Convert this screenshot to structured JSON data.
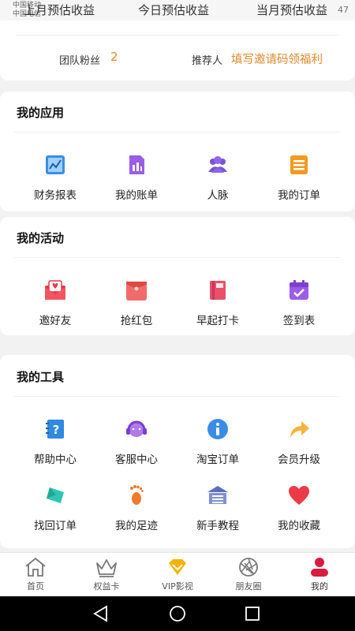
{
  "status_bar": {
    "carrier_top": "中国移动",
    "carrier_bottom": "中国电信",
    "ghost_labels": [
      "上月预估收益",
      "今日预估收益",
      "当月预估收益"
    ],
    "time": "47"
  },
  "fans": {
    "label": "团队粉丝",
    "value": "2",
    "referrer_label": "推荐人",
    "referrer_link": "填写邀请码领福利"
  },
  "sections": {
    "apps": {
      "title": "我的应用",
      "items": [
        {
          "label": "财务报表",
          "icon": "finance-report-icon"
        },
        {
          "label": "我的账单",
          "icon": "bill-icon"
        },
        {
          "label": "人脉",
          "icon": "contacts-icon"
        },
        {
          "label": "我的订单",
          "icon": "orders-icon"
        }
      ]
    },
    "activities": {
      "title": "我的活动",
      "items": [
        {
          "label": "邀好友",
          "icon": "invite-envelope-icon"
        },
        {
          "label": "抢红包",
          "icon": "red-envelope-icon"
        },
        {
          "label": "早起打卡",
          "icon": "checkin-book-icon"
        },
        {
          "label": "签到表",
          "icon": "calendar-check-icon"
        }
      ]
    },
    "tools": {
      "title": "我的工具",
      "items": [
        {
          "label": "帮助中心",
          "icon": "help-notebook-icon"
        },
        {
          "label": "客服中心",
          "icon": "headset-icon"
        },
        {
          "label": "淘宝订单",
          "icon": "info-icon"
        },
        {
          "label": "会员升级",
          "icon": "arrow-share-icon"
        },
        {
          "label": "找回订单",
          "icon": "diamond-shape-icon"
        },
        {
          "label": "我的足迹",
          "icon": "footprint-icon"
        },
        {
          "label": "新手教程",
          "icon": "school-building-icon"
        },
        {
          "label": "我的收藏",
          "icon": "heart-icon"
        }
      ]
    }
  },
  "tabbar": {
    "tabs": [
      {
        "label": "首页",
        "icon": "home-icon"
      },
      {
        "label": "权益卡",
        "icon": "crown-icon"
      },
      {
        "label": "VIP影视",
        "icon": "vip-diamond-icon"
      },
      {
        "label": "朋友圈",
        "icon": "aperture-icon"
      },
      {
        "label": "我的",
        "icon": "profile-icon"
      }
    ],
    "active_index": 4
  },
  "colors": {
    "accent_orange": "#e08a2c",
    "active_tab_red": "#d81b3f",
    "vip_yellow": "#f2b300"
  }
}
